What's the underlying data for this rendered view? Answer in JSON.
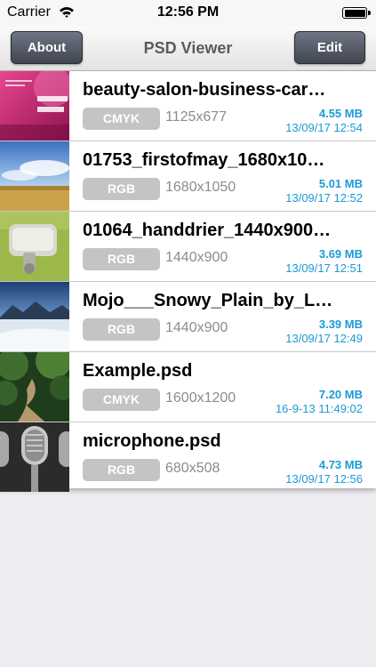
{
  "status_bar": {
    "carrier": "Carrier",
    "time": "12:56 PM"
  },
  "nav": {
    "title": "PSD Viewer",
    "left_button": "About",
    "right_button": "Edit"
  },
  "files": [
    {
      "name": "beauty-salon-business-car…",
      "mode": "CMYK",
      "dimensions": "1125x677",
      "size": "4.55 MB",
      "date": "13/09/17 12:54",
      "thumb": "beauty-salon-thumbnail"
    },
    {
      "name": "01753_firstofmay_1680x10…",
      "mode": "RGB",
      "dimensions": "1680x1050",
      "size": "5.01 MB",
      "date": "13/09/17 12:52",
      "thumb": "field-sky-thumbnail"
    },
    {
      "name": "01064_handdrier_1440x900…",
      "mode": "RGB",
      "dimensions": "1440x900",
      "size": "3.69 MB",
      "date": "13/09/17 12:51",
      "thumb": "handdrier-thumbnail"
    },
    {
      "name": "Mojo___Snowy_Plain_by_L…",
      "mode": "RGB",
      "dimensions": "1440x900",
      "size": "3.39 MB",
      "date": "13/09/17 12:49",
      "thumb": "snowy-plain-thumbnail"
    },
    {
      "name": "Example.psd",
      "mode": "CMYK",
      "dimensions": "1600x1200",
      "size": "7.20 MB",
      "date": "16-9-13 11:49:02",
      "thumb": "forest-path-thumbnail"
    },
    {
      "name": "microphone.psd",
      "mode": "RGB",
      "dimensions": "680x508",
      "size": "4.73 MB",
      "date": "13/09/17 12:56",
      "thumb": "microphone-thumbnail"
    }
  ],
  "colors": {
    "accent": "#1c9ad6",
    "nav_button": "#4f5460",
    "badge": "#c4c4c4"
  }
}
